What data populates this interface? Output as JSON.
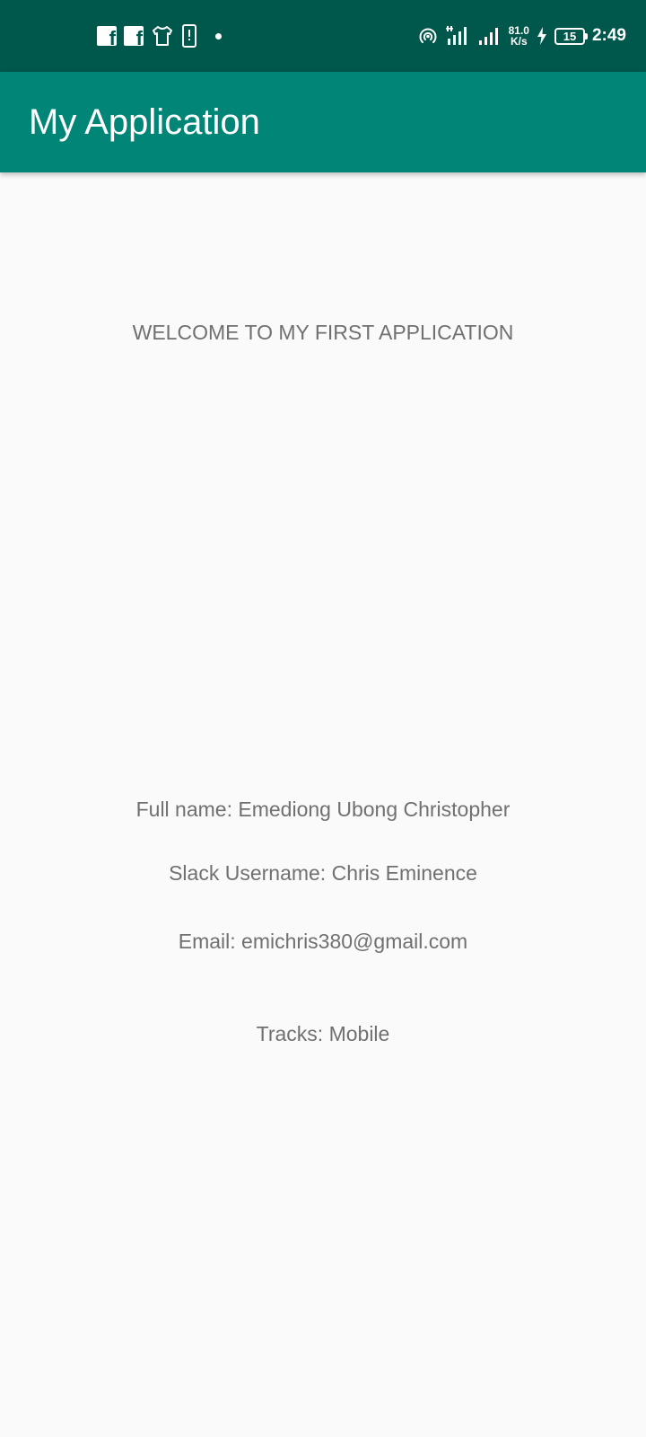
{
  "status_bar": {
    "left_icons": [
      "facebook-icon",
      "facebook-icon",
      "tshirt-icon",
      "phone-alert-icon",
      "notification-dot-icon"
    ],
    "right_icons": [
      "hotspot-icon",
      "signal-icon",
      "signal-icon",
      "charging-icon"
    ],
    "network_speed_value": "81.0",
    "network_speed_unit": "K/s",
    "battery_level": "15",
    "time": "2:49",
    "background_color": "#00574b"
  },
  "app_bar": {
    "title": "My Application",
    "background_color": "#008577"
  },
  "content": {
    "welcome_text": "WELCOME TO MY FIRST APPLICATION",
    "full_name": "Full name: Emediong Ubong Christopher",
    "slack_username": "Slack Username: Chris Eminence",
    "email": "Email: emichris380@gmail.com",
    "tracks": "Tracks: Mobile",
    "text_color": "#707070",
    "background_color": "#fafafa"
  }
}
